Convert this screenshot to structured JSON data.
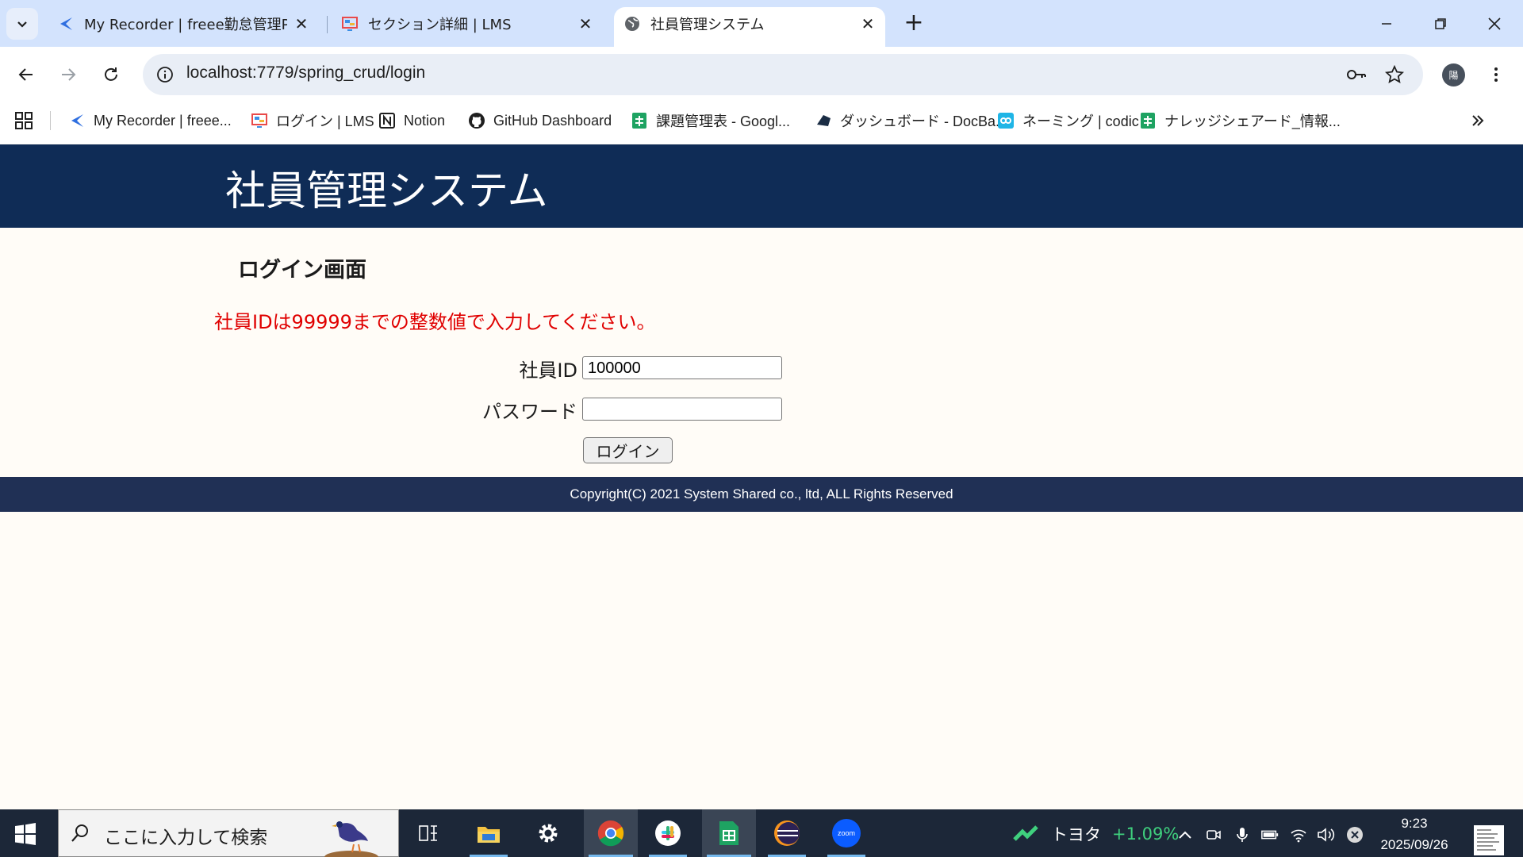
{
  "browser": {
    "tabs": [
      {
        "title": "My Recorder | freee勤怠管理Plu",
        "icon": "freee-logo-icon",
        "active": false
      },
      {
        "title": "セクション詳細 | LMS",
        "icon": "lms-monitor-icon",
        "active": false
      },
      {
        "title": "社員管理システム",
        "icon": "globe-icon",
        "active": true
      }
    ],
    "url": "localhost:7779/spring_crud/login",
    "profile_initial": "陽",
    "bookmarks": [
      {
        "label": "My Recorder | freee...",
        "icon": "freee-logo-icon"
      },
      {
        "label": "ログイン | LMS",
        "icon": "lms-monitor-icon"
      },
      {
        "label": "Notion",
        "icon": "notion-icon"
      },
      {
        "label": "GitHub Dashboard",
        "icon": "github-icon"
      },
      {
        "label": "課題管理表 - Googl...",
        "icon": "google-sheets-icon"
      },
      {
        "label": "ダッシュボード - DocBa...",
        "icon": "docbase-icon"
      },
      {
        "label": "ネーミング | codic",
        "icon": "codic-icon"
      },
      {
        "label": "ナレッジシェアード_情報...",
        "icon": "google-sheets-icon"
      }
    ]
  },
  "page": {
    "system_title": "社員管理システム",
    "login_heading": "ログイン画面",
    "error_message": "社員IDは99999までの整数値で入力してください。",
    "employee_id_label": "社員ID",
    "employee_id_value": "100000",
    "password_label": "パスワード",
    "password_value": "",
    "login_button": "ログイン",
    "copyright": "Copyright(C) 2021 System Shared co., ltd, ALL Rights Reserved"
  },
  "taskbar": {
    "search_placeholder": "ここに入力して検索",
    "stock_name": "トヨタ",
    "stock_change": "+1.09%",
    "time": "9:23",
    "date": "2025/09/26"
  },
  "colors": {
    "header_bg": "#0f2c56",
    "footer_bg": "#203055",
    "error_text": "#e00000",
    "page_bg": "#fffcf7"
  }
}
